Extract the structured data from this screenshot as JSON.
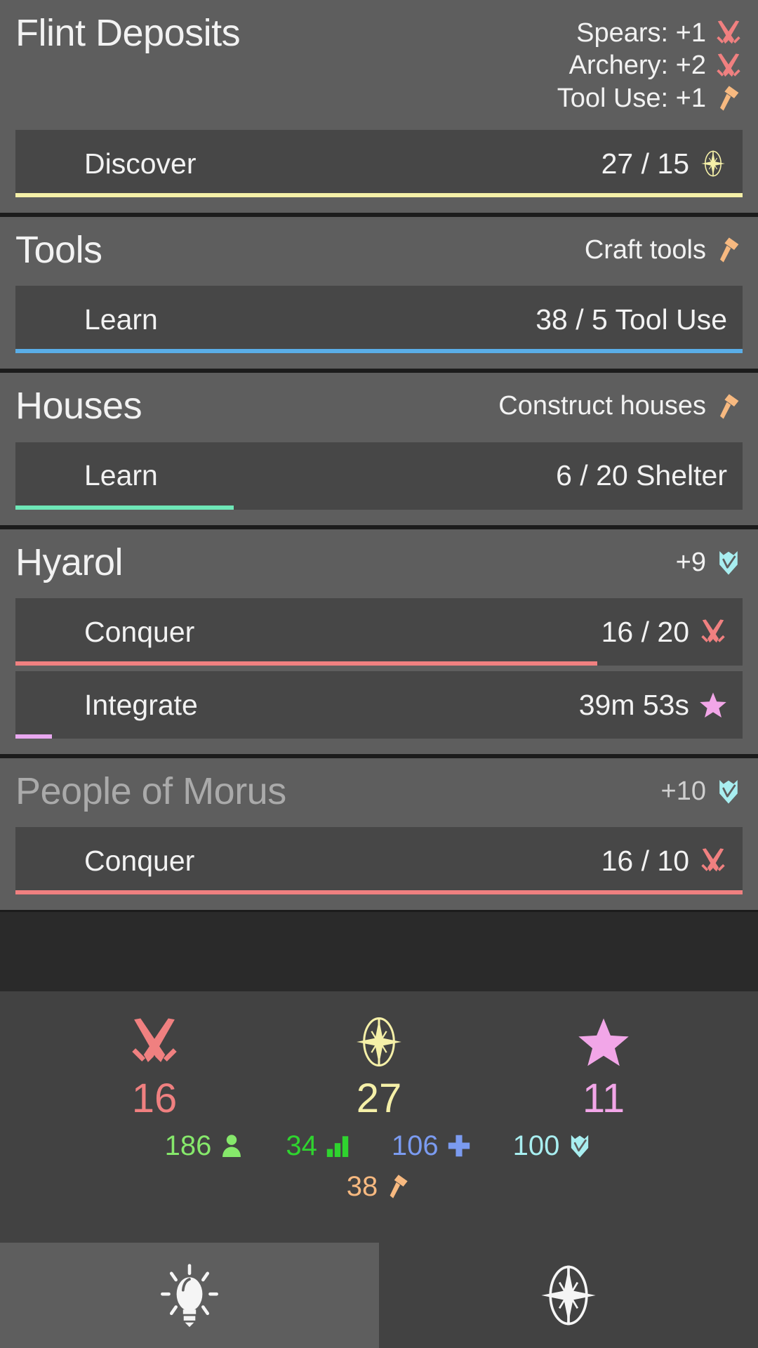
{
  "colors": {
    "page_bg": "#2a2a2a",
    "card_bg": "#5e5e5e",
    "row_bg": "#474747",
    "divider": "#1c1c1c",
    "text": "#f2f2f2",
    "war_red": "#f08080",
    "discover_yellow": "#f5f0a8",
    "tool_orange": "#f7b980",
    "shelter_green": "#6ee7b7",
    "learn_blue": "#5aaee8",
    "star_pink": "#f2a6e8",
    "integrate_pink": "#e9a8f0",
    "shield_cyan": "#a8eef0",
    "people_green": "#86e86b",
    "production_green": "#2fd42f",
    "health_blue": "#7b9bf0",
    "hud_bg": "#424242",
    "nav_active_bg": "#5e5e5e"
  },
  "cards": [
    {
      "title": "Flint Deposits",
      "faded": false,
      "meta": [
        {
          "label": "Spears: +1",
          "icon": "crossed-swords-icon",
          "icon_color": "#f08080"
        },
        {
          "label": "Archery: +2",
          "icon": "crossed-swords-icon",
          "icon_color": "#f08080"
        },
        {
          "label": "Tool Use: +1",
          "icon": "hammer-icon",
          "icon_color": "#f7b980"
        }
      ],
      "rows": [
        {
          "label": "Discover",
          "value": "27 / 15",
          "icon": "compass-rose-icon",
          "icon_color": "#f5f0a8",
          "bar_color": "#f5f0a8",
          "bar_percent": 100
        }
      ]
    },
    {
      "title": "Tools",
      "faded": false,
      "meta": [
        {
          "label": "Craft tools",
          "icon": "hammer-icon",
          "icon_color": "#f7b980"
        }
      ],
      "rows": [
        {
          "label": "Learn",
          "value": "38 / 5 Tool Use",
          "icon": "",
          "icon_color": "",
          "bar_color": "#5aaee8",
          "bar_percent": 100
        }
      ]
    },
    {
      "title": "Houses",
      "faded": false,
      "meta": [
        {
          "label": "Construct houses",
          "icon": "hammer-icon",
          "icon_color": "#f7b980"
        }
      ],
      "rows": [
        {
          "label": "Learn",
          "value": "6 / 20 Shelter",
          "icon": "",
          "icon_color": "",
          "bar_color": "#6ee7b7",
          "bar_percent": 30
        }
      ]
    },
    {
      "title": "Hyarol",
      "faded": false,
      "meta": [
        {
          "label": "+9",
          "icon": "shield-icon",
          "icon_color": "#a8eef0"
        }
      ],
      "rows": [
        {
          "label": "Conquer",
          "value": "16 / 20",
          "icon": "crossed-swords-icon",
          "icon_color": "#f08080",
          "bar_color": "#f08080",
          "bar_percent": 80
        },
        {
          "label": "Integrate",
          "value": "39m 53s",
          "icon": "star-icon",
          "icon_color": "#f2a6e8",
          "bar_color": "#e9a8f0",
          "bar_percent": 5
        }
      ]
    },
    {
      "title": "People of Morus",
      "faded": true,
      "meta": [
        {
          "label": "+10",
          "icon": "shield-icon",
          "icon_color": "#a8eef0"
        }
      ],
      "rows": [
        {
          "label": "Conquer",
          "value": "16 / 10",
          "icon": "crossed-swords-icon",
          "icon_color": "#f08080",
          "bar_color": "#f08080",
          "bar_percent": 100
        }
      ]
    }
  ],
  "hud": {
    "primary": [
      {
        "icon": "crossed-swords-icon",
        "value": "16",
        "color": "#f08080"
      },
      {
        "icon": "compass-rose-icon",
        "value": "27",
        "color": "#f5f0a8"
      },
      {
        "icon": "star-icon",
        "value": "11",
        "color": "#f2a6e8"
      }
    ],
    "secondary": [
      {
        "icon": "person-icon",
        "value": "186",
        "color": "#86e86b"
      },
      {
        "icon": "bar-chart-icon",
        "value": "34",
        "color": "#2fd42f"
      },
      {
        "icon": "plus-icon",
        "value": "106",
        "color": "#7b9bf0"
      },
      {
        "icon": "shield-icon",
        "value": "100",
        "color": "#a8eef0"
      }
    ],
    "secondary_row2": [
      {
        "icon": "hammer-icon",
        "value": "38",
        "color": "#f7b980"
      }
    ]
  },
  "nav": {
    "tabs": [
      {
        "icon": "lightbulb-icon",
        "name": "tab-ideas",
        "active": true
      },
      {
        "icon": "compass-rose-icon",
        "name": "tab-explore",
        "active": false
      }
    ]
  }
}
